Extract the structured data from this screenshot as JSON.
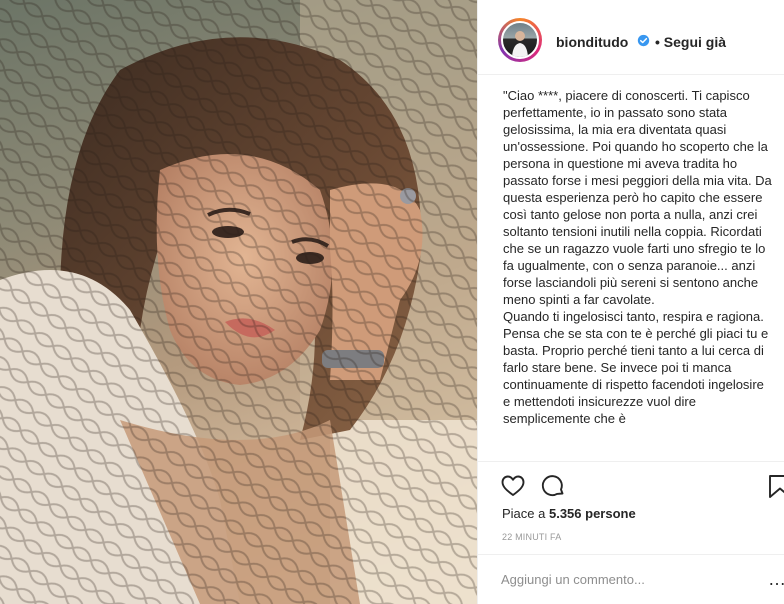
{
  "post": {
    "photo_icon": "portrait-photo",
    "username": "bionditudo",
    "verified_icon": "verified-badge-icon",
    "follow_label": "• Segui già",
    "caption": "\"Ciao ****, piacere di conoscerti. Ti capisco perfettamente, io in passato sono stata gelosissima, la mia era diventata quasi un'ossessione. Poi quando ho scoperto che la persona in questione mi aveva tradita ho passato forse i mesi peggiori della mia vita. Da questa esperienza però ho capito che essere così tanto gelose non porta a nulla, anzi crei soltanto tensioni inutili nella coppia. Ricordati che se un ragazzo vuole farti uno sfregio te lo fa ugualmente, con o senza paranoie... anzi forse lasciandoli più sereni si sentono anche meno spinti a far cavolate.\nQuando ti ingelosisci tanto, respira e ragiona. Pensa che se sta con te è perché gli piaci tu e basta. Proprio perché tieni tanto a lui cerca di farlo stare bene. Se invece poi ti manca continuamente di rispetto facendoti ingelosire e mettendoti insicurezze vuol dire semplicemente che è",
    "likes_label": "Piace a ",
    "likes_count": "5.356 persone",
    "time": "22 MINUTI FA",
    "comment_placeholder": "Aggiungi un commento...",
    "more_label": "…"
  },
  "icons": {
    "like": "heart-icon",
    "comment": "comment-icon",
    "save": "bookmark-icon"
  },
  "colors": {
    "text": "#262626",
    "muted": "#999999",
    "verified": "#3897f0",
    "divider": "#efefef"
  }
}
